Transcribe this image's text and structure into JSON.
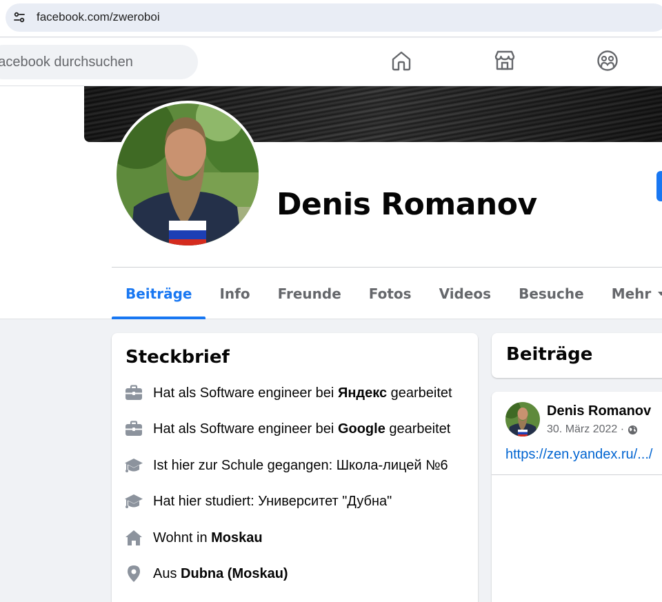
{
  "browser": {
    "url": "facebook.com/zweroboi"
  },
  "nav": {
    "search_placeholder": "Facebook durchsuchen",
    "icons": [
      "home-icon",
      "marketplace-icon",
      "groups-icon"
    ]
  },
  "profile": {
    "name": "Denis Romanov",
    "tabs": [
      {
        "label": "Beiträge",
        "active": true
      },
      {
        "label": "Info"
      },
      {
        "label": "Freunde"
      },
      {
        "label": "Fotos"
      },
      {
        "label": "Videos"
      },
      {
        "label": "Besuche"
      },
      {
        "label": "Mehr"
      }
    ]
  },
  "intro": {
    "title": "Steckbrief",
    "items": [
      {
        "icon": "briefcase-icon",
        "prefix": "Hat als Software engineer bei ",
        "bold": "Яндекс",
        "suffix": " gearbeitet"
      },
      {
        "icon": "briefcase-icon",
        "prefix": "Hat als Software engineer bei ",
        "bold": "Google",
        "suffix": " gearbeitet"
      },
      {
        "icon": "graduation-cap-icon",
        "prefix": "Ist hier zur Schule gegangen: Школа-лицей №6",
        "bold": "",
        "suffix": ""
      },
      {
        "icon": "graduation-cap-icon",
        "prefix": "Hat hier studiert: Университет \"Дубна\"",
        "bold": "",
        "suffix": ""
      },
      {
        "icon": "house-icon",
        "prefix": "Wohnt in ",
        "bold": "Moskau",
        "suffix": ""
      },
      {
        "icon": "location-pin-icon",
        "prefix": "Aus ",
        "bold": "Dubna (Moskau)",
        "suffix": ""
      }
    ]
  },
  "posts": {
    "title": "Beiträge",
    "first": {
      "author": "Denis Romanov",
      "date": "30. März 2022 ·",
      "link": "https://zen.yandex.ru/.../"
    }
  },
  "colors": {
    "accent": "#1877f2",
    "link": "#0064d1",
    "secondary_text": "#65676b"
  }
}
